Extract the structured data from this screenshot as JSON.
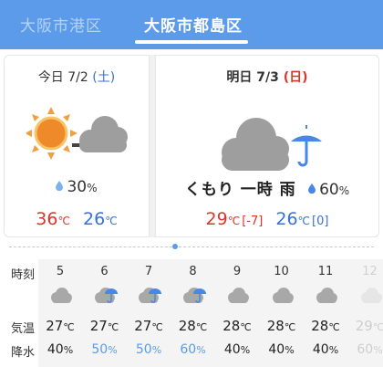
{
  "tabs": {
    "left": "大阪市港区",
    "right": "大阪市都島区"
  },
  "today": {
    "label": "今日",
    "date": "7/2",
    "dow_open": "(",
    "dow": "土",
    "dow_close": ")",
    "weather_icon": "sun-cloud-icon",
    "precip": "30",
    "precip_unit": "%",
    "temp_max": "36",
    "temp_min": "26",
    "temp_unit": "℃"
  },
  "tomorrow": {
    "label": "明日",
    "date": "7/3",
    "dow_open": "(",
    "dow": "日",
    "dow_close": ")",
    "weather_icon": "cloud-umbrella-icon",
    "description": "くもり 一時 雨",
    "precip": "60",
    "precip_unit": "%",
    "temp_max": "29",
    "temp_max_diff": "[-7]",
    "temp_min": "26",
    "temp_min_diff": "[0]",
    "temp_unit": "℃"
  },
  "hourly": {
    "labels": {
      "hour": "時刻",
      "temp": "気温",
      "precip": "降水"
    },
    "temp_unit": "℃",
    "precip_unit": "%",
    "hours": [
      {
        "time": "5",
        "icon": "cloud-icon",
        "temp": "27",
        "pop": "40",
        "rain": false
      },
      {
        "time": "6",
        "icon": "cloud-umbrella-icon",
        "temp": "27",
        "pop": "50",
        "rain": true
      },
      {
        "time": "7",
        "icon": "cloud-umbrella-icon",
        "temp": "27",
        "pop": "50",
        "rain": true
      },
      {
        "time": "8",
        "icon": "cloud-umbrella-icon",
        "temp": "28",
        "pop": "60",
        "rain": true
      },
      {
        "time": "9",
        "icon": "cloud-icon",
        "temp": "28",
        "pop": "40",
        "rain": false
      },
      {
        "time": "10",
        "icon": "cloud-icon",
        "temp": "28",
        "pop": "40",
        "rain": false
      },
      {
        "time": "11",
        "icon": "cloud-icon",
        "temp": "28",
        "pop": "40",
        "rain": false
      },
      {
        "time": "12",
        "icon": "cloud-icon",
        "temp": "29",
        "pop": "60",
        "rain": false
      }
    ]
  },
  "colors": {
    "accent": "#5b9bea",
    "hot": "#d9362b",
    "cold": "#3a6fd8",
    "saturday": "#3a6fd8",
    "sunday": "#d9362b"
  }
}
